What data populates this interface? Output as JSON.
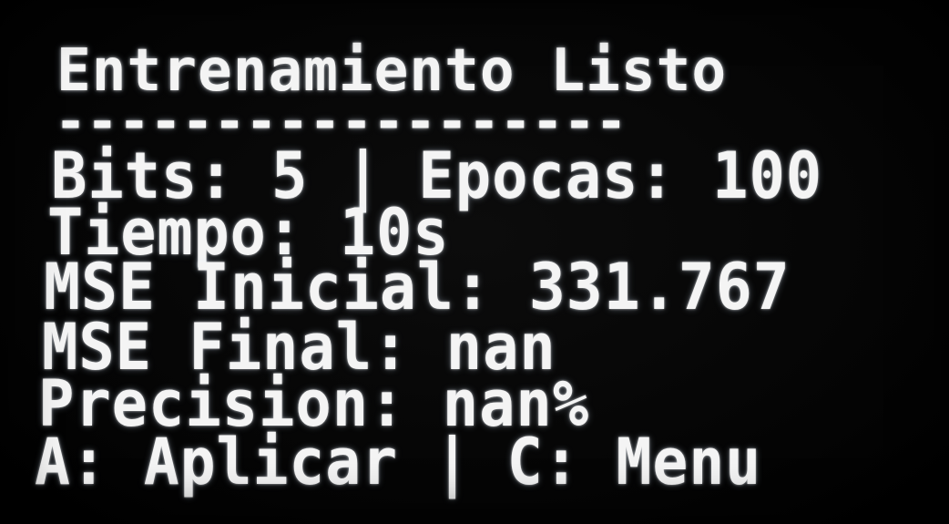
{
  "screen": {
    "title": "Entrenamiento Listo",
    "separator": "------------------",
    "lines": [
      "Bits: 5 | Epocas: 100",
      "Tiempo: 10s",
      "MSE Inicial: 331.767",
      "MSE Final: nan",
      "Precision: nan%",
      "A: Aplicar | C: Menu"
    ]
  },
  "colors": {
    "background": "#050505",
    "text": "#f4f4f4"
  }
}
